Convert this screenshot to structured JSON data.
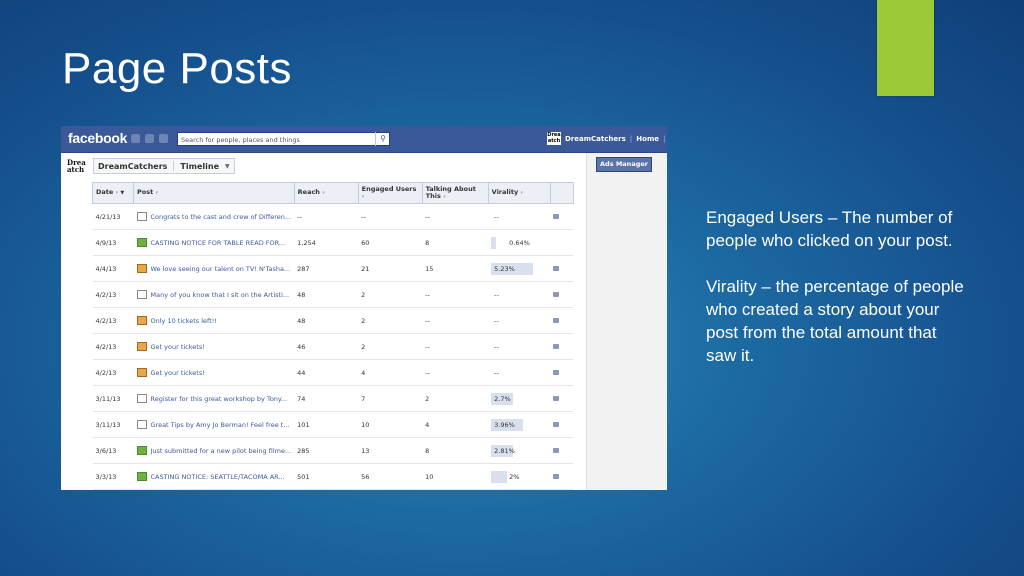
{
  "slide": {
    "title": "Page Posts",
    "notes": [
      "Engaged Users – The number of people who clicked on your post.",
      "Virality – the percentage of people who created a story about your post from the total amount that saw it."
    ]
  },
  "facebook": {
    "logo": "facebook",
    "search_placeholder": "Search for people, places and things",
    "page_name": "DreamCatchers",
    "home_label": "Home",
    "thumb_text": "Drea\natch",
    "timeline_label": "Timeline",
    "ads_manager_label": "Ads Manager",
    "columns": [
      "Date",
      "Post",
      "Reach",
      "Engaged Users",
      "Talking About This",
      "Virality"
    ],
    "rows": [
      {
        "date": "4/21/13",
        "icon": "link",
        "post": "Congrats to the cast and crew of Differen...",
        "reach": "--",
        "engaged": "--",
        "talking": "--",
        "virality": "--",
        "virality_pct": 0,
        "flag": true
      },
      {
        "date": "4/9/13",
        "icon": "status",
        "post": "CASTING NOTICE FOR TABLE READ FOR...",
        "reach": "1,254",
        "engaged": "60",
        "talking": "8",
        "virality": "0.64%",
        "virality_pct": 0.64,
        "flag": false
      },
      {
        "date": "4/4/13",
        "icon": "photo",
        "post": "We love seeing our talent on TV! N'Tasha...",
        "reach": "287",
        "engaged": "21",
        "talking": "15",
        "virality": "5.23%",
        "virality_pct": 5.23,
        "flag": true
      },
      {
        "date": "4/2/13",
        "icon": "link",
        "post": "Many of you know that I sit on the Artisti...",
        "reach": "48",
        "engaged": "2",
        "talking": "--",
        "virality": "--",
        "virality_pct": 0,
        "flag": true
      },
      {
        "date": "4/2/13",
        "icon": "photo",
        "post": "Only 10 tickets left!!",
        "reach": "48",
        "engaged": "2",
        "talking": "--",
        "virality": "--",
        "virality_pct": 0,
        "flag": true
      },
      {
        "date": "4/2/13",
        "icon": "photo",
        "post": "Get your tickets!",
        "reach": "46",
        "engaged": "2",
        "talking": "--",
        "virality": "--",
        "virality_pct": 0,
        "flag": true
      },
      {
        "date": "4/2/13",
        "icon": "photo",
        "post": "Get your tickets!",
        "reach": "44",
        "engaged": "4",
        "talking": "--",
        "virality": "--",
        "virality_pct": 0,
        "flag": true
      },
      {
        "date": "3/11/13",
        "icon": "link",
        "post": "Register for this great workshop by Tony...",
        "reach": "74",
        "engaged": "7",
        "talking": "2",
        "virality": "2.7%",
        "virality_pct": 2.7,
        "flag": true
      },
      {
        "date": "3/11/13",
        "icon": "link",
        "post": "Great Tips by Amy Jo Berman! Feel free t...",
        "reach": "101",
        "engaged": "10",
        "talking": "4",
        "virality": "3.96%",
        "virality_pct": 3.96,
        "flag": true
      },
      {
        "date": "3/6/13",
        "icon": "status",
        "post": "Just submitted for a new pilot being filme...",
        "reach": "285",
        "engaged": "13",
        "talking": "8",
        "virality": "2.81%",
        "virality_pct": 2.81,
        "flag": true
      },
      {
        "date": "3/3/13",
        "icon": "status",
        "post": "CASTING NOTICE: SEATTLE/TACOMA AR...",
        "reach": "501",
        "engaged": "56",
        "talking": "10",
        "virality": "2%",
        "virality_pct": 2,
        "flag": true
      }
    ]
  }
}
